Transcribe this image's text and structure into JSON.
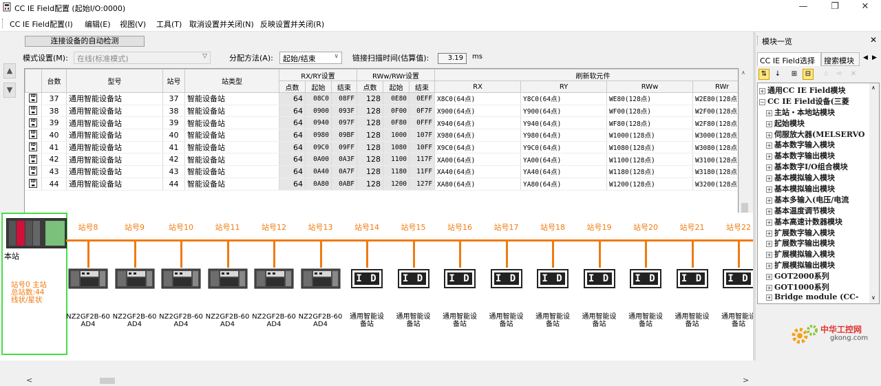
{
  "window": {
    "title": "CC IE Field配置 (起始I/O:0000)"
  },
  "menu": [
    "CC IE Field配置(I)",
    "编辑(E)",
    "视图(V)",
    "工具(T)",
    "取消设置并关闭(N)",
    "反映设置并关闭(R)"
  ],
  "toolbar": {
    "detect_button": "连接设备的自动检测",
    "mode_label": "模式设置(M):",
    "mode_value": "在线(标准模式)",
    "assign_label": "分配方法(A):",
    "assign_value": "起始/结束",
    "scan_label": "链接扫描时间(估算值):",
    "scan_value": "3.19",
    "scan_unit": "ms"
  },
  "table": {
    "headers": {
      "count": "台数",
      "model": "型号",
      "station": "站号",
      "station_type": "站类型",
      "rxry": "RX/RY设置",
      "rwwr": "RWw/RWr设置",
      "refresh": "刷新软元件",
      "points": "点数",
      "start": "起始",
      "end": "结束",
      "rx": "RX",
      "ry": "RY",
      "rww": "RWw",
      "rwr": "RWr"
    },
    "rows": [
      {
        "n": "37",
        "model": "通用智能设备站",
        "st": "37",
        "type": "智能设备站",
        "p1": "64",
        "s1": "08C0",
        "e1": "08FF",
        "p2": "128",
        "s2": "0E80",
        "e2": "0EFF",
        "rx": "X8C0(64点)",
        "ry": "Y8C0(64点)",
        "rww": "WE80(128点)",
        "rwr": "W2E80(128点"
      },
      {
        "n": "38",
        "model": "通用智能设备站",
        "st": "38",
        "type": "智能设备站",
        "p1": "64",
        "s1": "0900",
        "e1": "093F",
        "p2": "128",
        "s2": "0F00",
        "e2": "0F7F",
        "rx": "X900(64点)",
        "ry": "Y900(64点)",
        "rww": "WF00(128点)",
        "rwr": "W2F00(128点"
      },
      {
        "n": "39",
        "model": "通用智能设备站",
        "st": "39",
        "type": "智能设备站",
        "p1": "64",
        "s1": "0940",
        "e1": "097F",
        "p2": "128",
        "s2": "0F80",
        "e2": "0FFF",
        "rx": "X940(64点)",
        "ry": "Y940(64点)",
        "rww": "WF80(128点)",
        "rwr": "W2F80(128点"
      },
      {
        "n": "40",
        "model": "通用智能设备站",
        "st": "40",
        "type": "智能设备站",
        "p1": "64",
        "s1": "0980",
        "e1": "09BF",
        "p2": "128",
        "s2": "1000",
        "e2": "107F",
        "rx": "X980(64点)",
        "ry": "Y980(64点)",
        "rww": "W1000(128点)",
        "rwr": "W3000(128点"
      },
      {
        "n": "41",
        "model": "通用智能设备站",
        "st": "41",
        "type": "智能设备站",
        "p1": "64",
        "s1": "09C0",
        "e1": "09FF",
        "p2": "128",
        "s2": "1080",
        "e2": "10FF",
        "rx": "X9C0(64点)",
        "ry": "Y9C0(64点)",
        "rww": "W1080(128点)",
        "rwr": "W3080(128点"
      },
      {
        "n": "42",
        "model": "通用智能设备站",
        "st": "42",
        "type": "智能设备站",
        "p1": "64",
        "s1": "0A00",
        "e1": "0A3F",
        "p2": "128",
        "s2": "1100",
        "e2": "117F",
        "rx": "XA00(64点)",
        "ry": "YA00(64点)",
        "rww": "W1100(128点)",
        "rwr": "W3100(128点"
      },
      {
        "n": "43",
        "model": "通用智能设备站",
        "st": "43",
        "type": "智能设备站",
        "p1": "64",
        "s1": "0A40",
        "e1": "0A7F",
        "p2": "128",
        "s2": "1180",
        "e2": "11FF",
        "rx": "XA40(64点)",
        "ry": "YA40(64点)",
        "rww": "W1180(128点)",
        "rwr": "W3180(128点"
      },
      {
        "n": "44",
        "model": "通用智能设备站",
        "st": "44",
        "type": "智能设备站",
        "p1": "64",
        "s1": "0A80",
        "e1": "0ABF",
        "p2": "128",
        "s2": "1200",
        "e2": "127F",
        "rx": "XA80(64点)",
        "ry": "YA80(64点)",
        "rww": "W1200(128点)",
        "rwr": "W3200(128点"
      }
    ]
  },
  "diagram": {
    "host": {
      "label": "本站",
      "info1": "站号0  主站",
      "info2": "总站数:44",
      "info3": "线状/星状"
    },
    "stations": [
      {
        "label": "站号8",
        "kind": "module",
        "model": "NZ2GF2B-60",
        "model2": "AD4"
      },
      {
        "label": "站号9",
        "kind": "module",
        "model": "NZ2GF2B-60",
        "model2": "AD4"
      },
      {
        "label": "站号10",
        "kind": "module",
        "model": "NZ2GF2B-60",
        "model2": "AD4"
      },
      {
        "label": "站号11",
        "kind": "module",
        "model": "NZ2GF2B-60",
        "model2": "AD4"
      },
      {
        "label": "站号12",
        "kind": "module",
        "model": "NZ2GF2B-60",
        "model2": "AD4"
      },
      {
        "label": "站号13",
        "kind": "module",
        "model": "NZ2GF2B-60",
        "model2": "AD4"
      },
      {
        "label": "站号14",
        "kind": "id",
        "model": "通用智能设",
        "model2": "备站"
      },
      {
        "label": "站号15",
        "kind": "id",
        "model": "通用智能设",
        "model2": "备站"
      },
      {
        "label": "站号16",
        "kind": "id",
        "model": "通用智能设",
        "model2": "备站"
      },
      {
        "label": "站号17",
        "kind": "id",
        "model": "通用智能设",
        "model2": "备站"
      },
      {
        "label": "站号18",
        "kind": "id",
        "model": "通用智能设",
        "model2": "备站"
      },
      {
        "label": "站号19",
        "kind": "id",
        "model": "通用智能设",
        "model2": "备站"
      },
      {
        "label": "站号20",
        "kind": "id",
        "model": "通用智能设",
        "model2": "备站"
      },
      {
        "label": "站号21",
        "kind": "id",
        "model": "通用智能设",
        "model2": "备站"
      },
      {
        "label": "站号22",
        "kind": "id",
        "model": "通用智能设",
        "model2": "备站"
      }
    ],
    "id_text": "I D"
  },
  "module_list": {
    "title": "模块一览",
    "tabs": [
      "CC IE Field选择",
      "搜索模块"
    ],
    "items": [
      {
        "sign": "⊞",
        "label": "通用CC IE Field模块",
        "level": 0
      },
      {
        "sign": "⊟",
        "label": "CC IE Field设备(三菱",
        "level": 0
      },
      {
        "sign": "⊞",
        "label": "主站・本地站模块",
        "level": 1
      },
      {
        "sign": "⊞",
        "label": "起始模块",
        "level": 1
      },
      {
        "sign": "⊞",
        "label": "伺服放大器(MELSERVO",
        "level": 1
      },
      {
        "sign": "⊞",
        "label": "基本数字输入模块",
        "level": 1
      },
      {
        "sign": "⊞",
        "label": "基本数字输出模块",
        "level": 1
      },
      {
        "sign": "⊞",
        "label": "基本数字I/O组合模块",
        "level": 1
      },
      {
        "sign": "⊞",
        "label": "基本模拟输入模块",
        "level": 1
      },
      {
        "sign": "⊞",
        "label": "基本模拟输出模块",
        "level": 1
      },
      {
        "sign": "⊞",
        "label": "基本多输入(电压/电流",
        "level": 1
      },
      {
        "sign": "⊞",
        "label": "基本温度调节模块",
        "level": 1
      },
      {
        "sign": "⊞",
        "label": "基本高速计数器模块",
        "level": 1
      },
      {
        "sign": "⊞",
        "label": "扩展数字输入模块",
        "level": 1
      },
      {
        "sign": "⊞",
        "label": "扩展数字输出模块",
        "level": 1
      },
      {
        "sign": "⊞",
        "label": "扩展模拟输入模块",
        "level": 1
      },
      {
        "sign": "⊞",
        "label": "扩展模拟输出模块",
        "level": 1
      },
      {
        "sign": "⊞",
        "label": "GOT2000系列",
        "level": 1
      },
      {
        "sign": "⊞",
        "label": "GOT1000系列",
        "level": 1
      },
      {
        "sign": "⊞",
        "label": "Bridge module (CC-",
        "level": 1
      }
    ]
  },
  "watermark": {
    "brand": "中华工控网",
    "url": "gkong.com"
  },
  "colors": {
    "bus": "#f07a10",
    "host_border": "#44dd44",
    "accent": "#cc2233"
  }
}
